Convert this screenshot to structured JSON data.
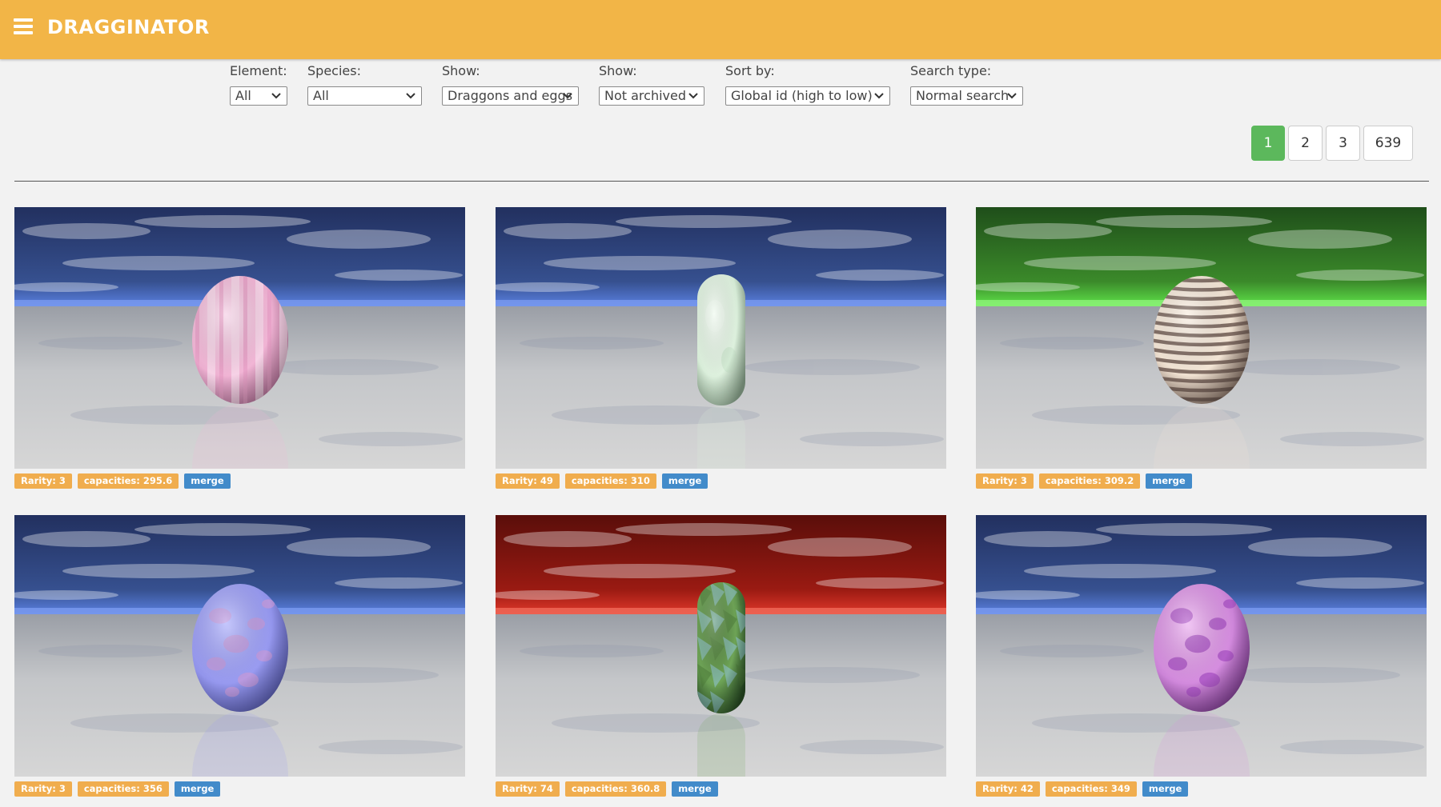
{
  "app": {
    "title": "DRAGGINATOR"
  },
  "filters": [
    {
      "label": "Element:",
      "value": "All"
    },
    {
      "label": "Species:",
      "value": "All"
    },
    {
      "label": "Show:",
      "value": "Draggons and eggs"
    },
    {
      "label": "Show:",
      "value": "Not archived"
    },
    {
      "label": "Sort by:",
      "value": "Global id (high to low)"
    },
    {
      "label": "Search type:",
      "value": "Normal search"
    }
  ],
  "pagination": {
    "pages": [
      "1",
      "2",
      "3",
      "639"
    ],
    "current": "1"
  },
  "colors": {
    "header": "#f2b547",
    "badge_orange": "#f0ad4e",
    "badge_blue": "#428bca",
    "page_active": "#5cb85c"
  },
  "cards": [
    {
      "rarity": "Rarity: 3",
      "capacities": "capacities: 295.6",
      "merge": "merge",
      "sky": "blue",
      "egg_shape": "egg",
      "egg_pattern": "pink vertical stripes"
    },
    {
      "rarity": "Rarity: 49",
      "capacities": "capacities: 310",
      "merge": "merge",
      "sky": "blue",
      "egg_shape": "capsule",
      "egg_pattern": "pale mint lumpy"
    },
    {
      "rarity": "Rarity: 3",
      "capacities": "capacities: 309.2",
      "merge": "merge",
      "sky": "green",
      "egg_shape": "egg",
      "egg_pattern": "cream horizontal stripes"
    },
    {
      "rarity": "Rarity: 3",
      "capacities": "capacities: 356",
      "merge": "merge",
      "sky": "blue",
      "egg_shape": "egg",
      "egg_pattern": "lavender blotches"
    },
    {
      "rarity": "Rarity: 74",
      "capacities": "capacities: 360.8",
      "merge": "merge",
      "sky": "red",
      "egg_shape": "capsule",
      "egg_pattern": "green faceted"
    },
    {
      "rarity": "Rarity: 42",
      "capacities": "capacities: 349",
      "merge": "merge",
      "sky": "blue",
      "egg_shape": "egg",
      "egg_pattern": "magenta mottled"
    }
  ]
}
